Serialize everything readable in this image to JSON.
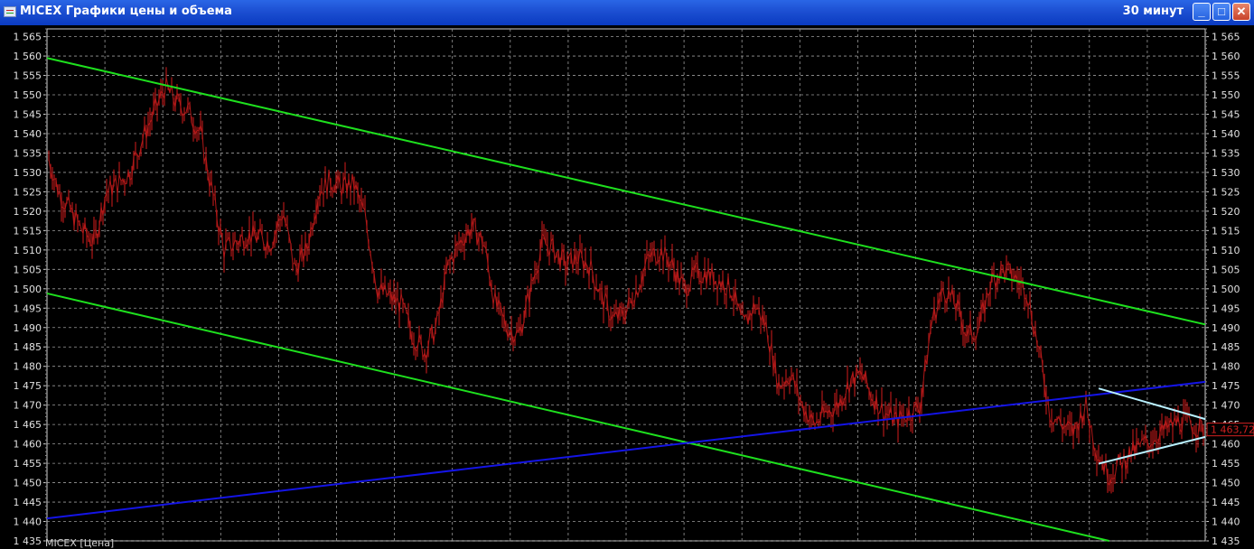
{
  "window": {
    "title": "MICEX Графики цены и объема",
    "timeframe": "30 минут",
    "buttons": {
      "minimize": "_",
      "maximize": "□",
      "close": "✕"
    }
  },
  "footer_label": "MICEX [Цена]",
  "colors": {
    "background": "#000000",
    "grid": "#9a9a9a",
    "price": "#b01818",
    "channel_green": "#1ee01e",
    "trend_blue": "#1414e6",
    "triangle_cyan": "#b8f0ff",
    "price_tag": "#d02020"
  },
  "chart_data": {
    "type": "line",
    "title": "",
    "xlabel": "",
    "ylabel": "",
    "ylim": [
      1435,
      1567
    ],
    "y_ticks": [
      "1 565",
      "1 560",
      "1 555",
      "1 550",
      "1 545",
      "1 540",
      "1 535",
      "1 530",
      "1 525",
      "1 520",
      "1 515",
      "1 510",
      "1 505",
      "1 500",
      "1 495",
      "1 490",
      "1 485",
      "1 480",
      "1 475",
      "1 470",
      "1 465",
      "1 460",
      "1 455",
      "1 450",
      "1 445",
      "1 440",
      "1 435"
    ],
    "y_tick_values": [
      1565,
      1560,
      1555,
      1550,
      1545,
      1540,
      1535,
      1530,
      1525,
      1520,
      1515,
      1510,
      1505,
      1500,
      1495,
      1490,
      1485,
      1480,
      1475,
      1470,
      1465,
      1460,
      1455,
      1450,
      1445,
      1440,
      1435
    ],
    "last_price": "1 463,72",
    "last_price_value": 1463.72,
    "price_series": [
      1535,
      1525,
      1520,
      1515,
      1512,
      1525,
      1527,
      1530,
      1538,
      1545,
      1552,
      1548,
      1546,
      1540,
      1525,
      1510,
      1512,
      1514,
      1513,
      1512,
      1520,
      1505,
      1510,
      1525,
      1528,
      1526,
      1527,
      1518,
      1500,
      1498,
      1496,
      1488,
      1484,
      1490,
      1506,
      1512,
      1516,
      1512,
      1496,
      1490,
      1488,
      1500,
      1512,
      1510,
      1506,
      1508,
      1506,
      1498,
      1492,
      1494,
      1500,
      1508,
      1510,
      1506,
      1500,
      1504,
      1504,
      1502,
      1500,
      1490,
      1496,
      1490,
      1475,
      1478,
      1470,
      1465,
      1468,
      1470,
      1476,
      1478,
      1472,
      1468,
      1466,
      1468,
      1470,
      1492,
      1500,
      1496,
      1488,
      1490,
      1502,
      1505,
      1503,
      1500,
      1485,
      1468,
      1465,
      1463,
      1470,
      1458,
      1452,
      1455,
      1458,
      1460,
      1462,
      1464,
      1466,
      1465,
      1463.72
    ],
    "series": [
      {
        "name": "",
        "type": "line",
        "color": "#1ee01e",
        "points": [
          [
            0,
            1559.5
          ],
          [
            1,
            1490.8
          ]
        ]
      },
      {
        "name": "",
        "type": "line",
        "color": "#1ee01e",
        "points": [
          [
            0,
            1498.8
          ],
          [
            0.917,
            1435
          ]
        ]
      },
      {
        "name": "",
        "type": "line",
        "color": "#1414e6",
        "points": [
          [
            0,
            1440.8
          ],
          [
            1,
            1476.0
          ]
        ]
      },
      {
        "name": "",
        "type": "line",
        "color": "#b8f0ff",
        "points": [
          [
            0.908,
            1474.3
          ],
          [
            1,
            1466.4
          ]
        ]
      },
      {
        "name": "",
        "type": "line",
        "color": "#b8f0ff",
        "points": [
          [
            0.908,
            1454.9
          ],
          [
            1,
            1461.8
          ]
        ]
      }
    ],
    "grid": true
  }
}
